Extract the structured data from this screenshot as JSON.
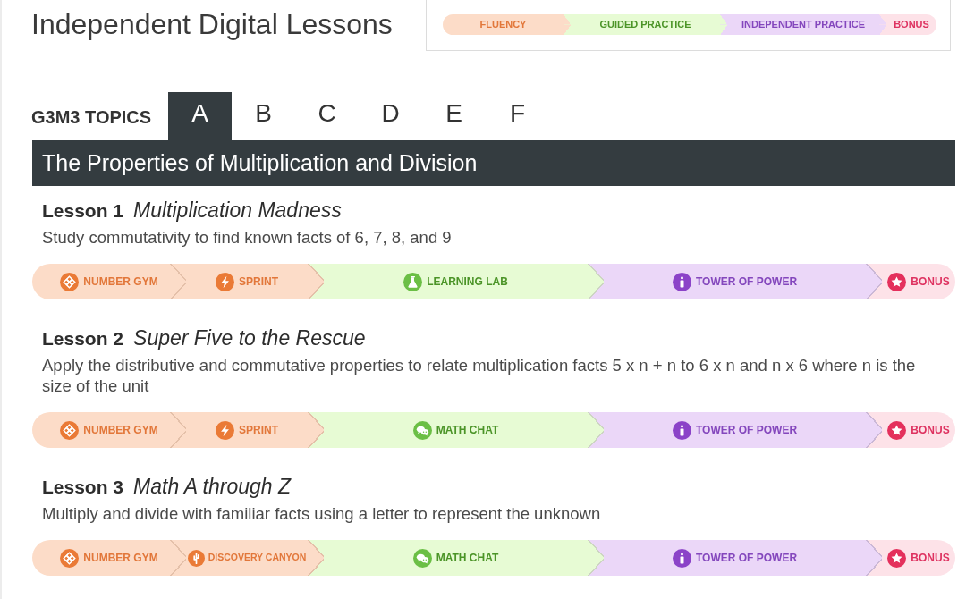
{
  "page_title": "Independent Digital Lessons",
  "legend": [
    {
      "label": "FLUENCY",
      "kind": "fluency"
    },
    {
      "label": "GUIDED PRACTICE",
      "kind": "guided"
    },
    {
      "label": "INDEPENDENT PRACTICE",
      "kind": "independent"
    },
    {
      "label": "BONUS",
      "kind": "bonus"
    }
  ],
  "topics": {
    "label": "G3M3 TOPICS",
    "tabs": [
      {
        "label": "A",
        "selected": true
      },
      {
        "label": "B",
        "selected": false
      },
      {
        "label": "C",
        "selected": false
      },
      {
        "label": "D",
        "selected": false
      },
      {
        "label": "E",
        "selected": false
      },
      {
        "label": "F",
        "selected": false
      }
    ]
  },
  "topic_title": "The Properties of Multiplication and Division",
  "lessons": [
    {
      "label": "Lesson 1",
      "title": "Multiplication Madness",
      "description": "Study commutativity to find known facts of 6, 7, 8, and 9",
      "activities": [
        {
          "label": "NUMBER GYM",
          "kind": "number_gym"
        },
        {
          "label": "SPRINT",
          "kind": "sprint"
        },
        {
          "label": "LEARNING LAB",
          "kind": "learning_lab"
        },
        {
          "label": "TOWER OF POWER",
          "kind": "tower_of_power"
        },
        {
          "label": "BONUS",
          "kind": "bonus"
        }
      ]
    },
    {
      "label": "Lesson 2",
      "title": "Super Five to the Rescue",
      "description": "Apply the distributive and commutative properties to relate multiplication facts 5 x n + n to 6 x n and n x 6 where n is the size of the unit",
      "activities": [
        {
          "label": "NUMBER GYM",
          "kind": "number_gym"
        },
        {
          "label": "SPRINT",
          "kind": "sprint"
        },
        {
          "label": "MATH CHAT",
          "kind": "math_chat"
        },
        {
          "label": "TOWER OF POWER",
          "kind": "tower_of_power"
        },
        {
          "label": "BONUS",
          "kind": "bonus"
        }
      ]
    },
    {
      "label": "Lesson 3",
      "title": "Math A through Z",
      "description": "Multiply and divide with familiar facts using a letter to represent the unknown",
      "activities": [
        {
          "label": "NUMBER GYM",
          "kind": "number_gym"
        },
        {
          "label": "DISCOVERY CANYON",
          "kind": "discovery_canyon"
        },
        {
          "label": "MATH CHAT",
          "kind": "math_chat"
        },
        {
          "label": "TOWER OF POWER",
          "kind": "tower_of_power"
        },
        {
          "label": "BONUS",
          "kind": "bonus"
        }
      ]
    }
  ]
}
